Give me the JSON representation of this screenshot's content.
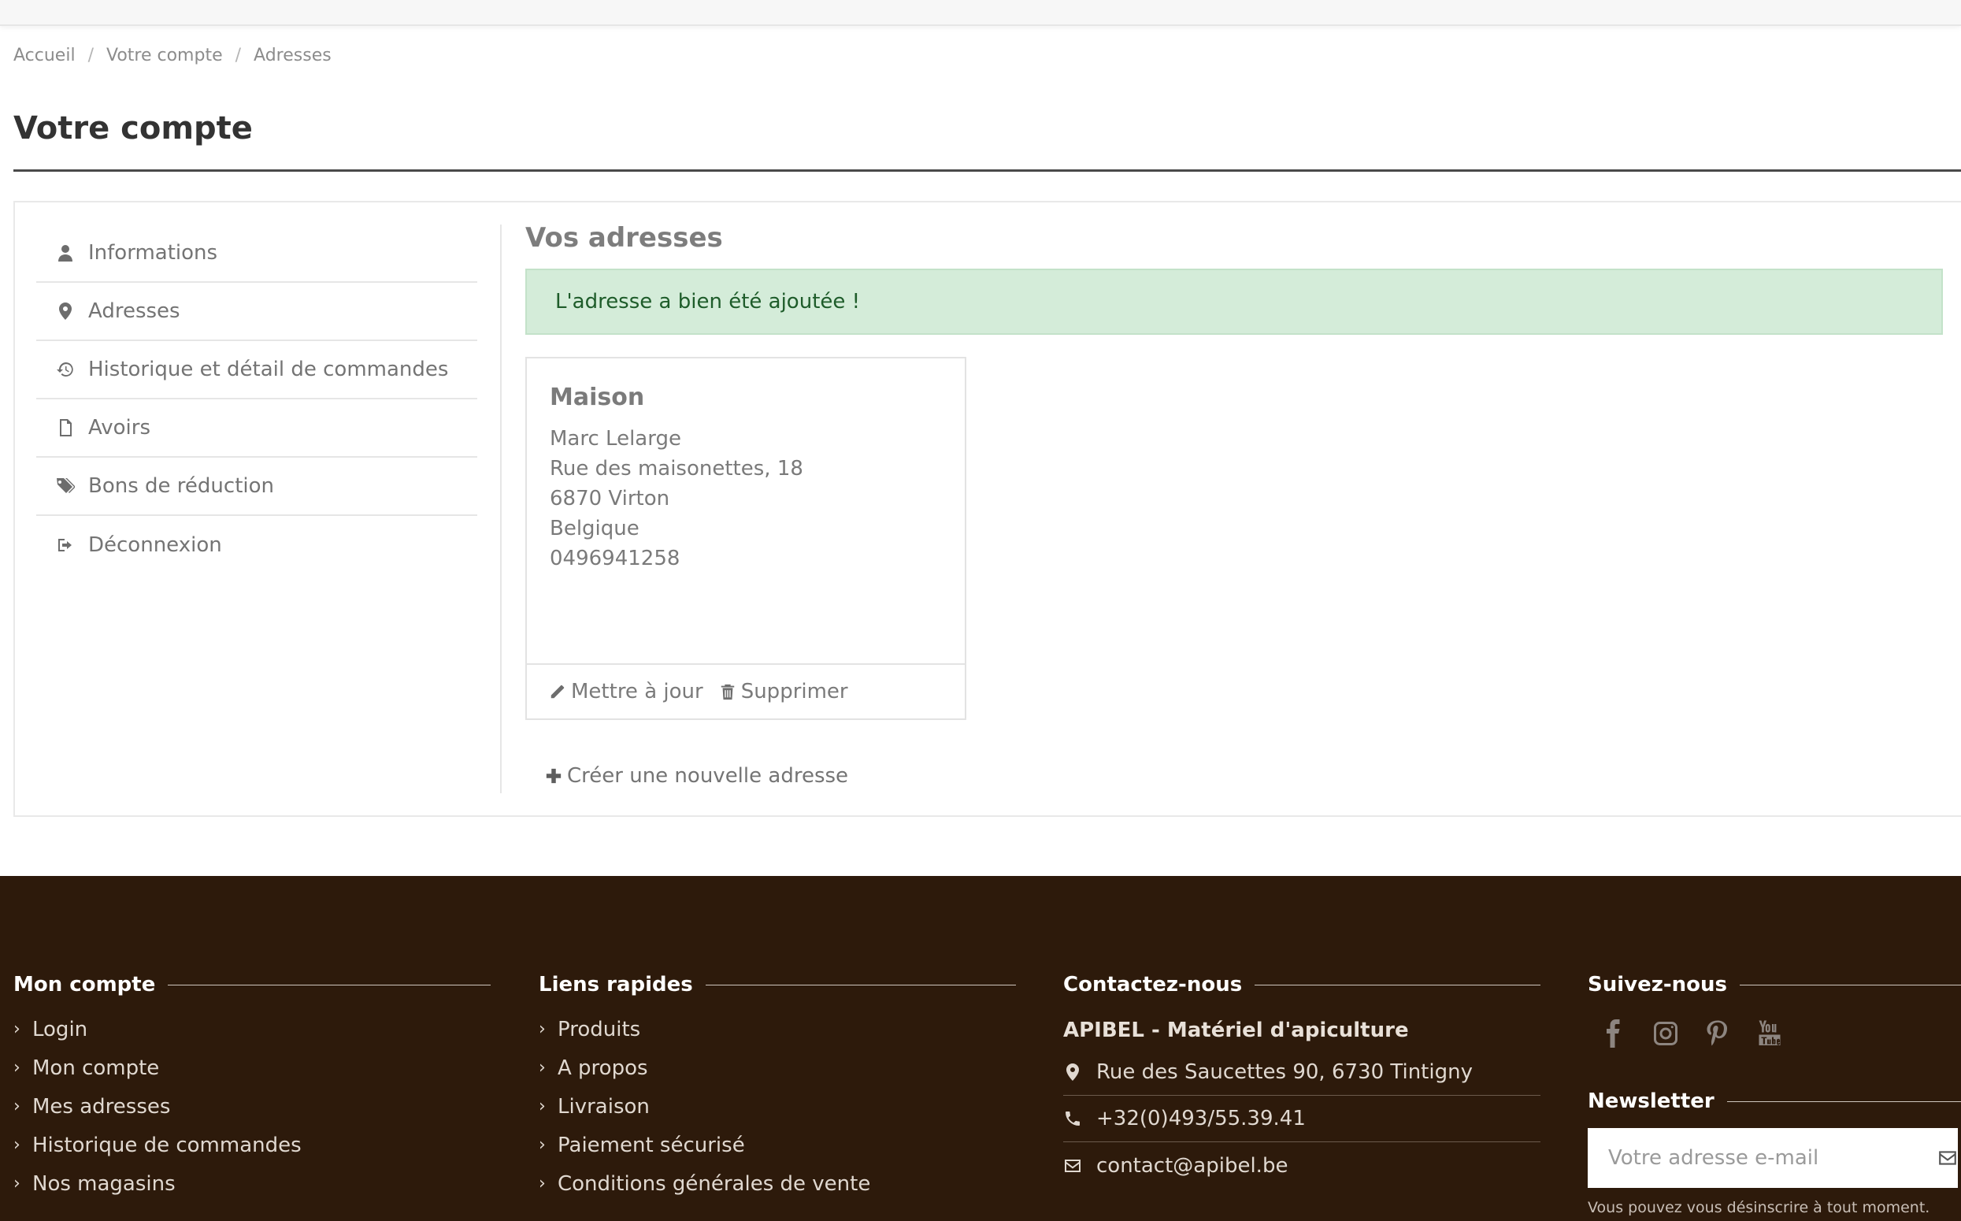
{
  "breadcrumb": [
    "Accueil",
    "Votre compte",
    "Adresses"
  ],
  "page_title": "Votre compte",
  "sidebar": {
    "items": [
      {
        "label": "Informations",
        "icon": "user-icon"
      },
      {
        "label": "Adresses",
        "icon": "map-marker-icon"
      },
      {
        "label": "Historique et détail de commandes",
        "icon": "history-icon"
      },
      {
        "label": "Avoirs",
        "icon": "file-icon"
      },
      {
        "label": "Bons de réduction",
        "icon": "tags-icon"
      },
      {
        "label": "Déconnexion",
        "icon": "sign-out-icon"
      }
    ]
  },
  "main": {
    "title": "Vos adresses",
    "alert": "L'adresse a bien été ajoutée !",
    "address": {
      "alias": "Maison",
      "lines": [
        "Marc Lelarge",
        "Rue des maisonettes, 18",
        "6870 Virton",
        "Belgique",
        "0496941258"
      ],
      "update_label": "Mettre à jour",
      "delete_label": "Supprimer"
    },
    "create_label": "Créer une nouvelle adresse"
  },
  "footer": {
    "account": {
      "title": "Mon compte",
      "links": [
        "Login",
        "Mon compte",
        "Mes adresses",
        "Historique de commandes",
        "Nos magasins"
      ]
    },
    "quick_links": {
      "title": "Liens rapides",
      "links": [
        "Produits",
        "A propos",
        "Livraison",
        "Paiement sécurisé",
        "Conditions générales de vente"
      ]
    },
    "contact": {
      "title": "Contactez-nous",
      "company": "APIBEL - Matériel d'apiculture",
      "address": "Rue des Saucettes 90, 6730 Tintigny",
      "phone": "+32(0)493/55.39.41",
      "email": "contact@apibel.be"
    },
    "follow": {
      "title": "Suivez-nous",
      "networks": [
        "facebook-icon",
        "instagram-icon",
        "pinterest-icon",
        "youtube-icon"
      ]
    },
    "newsletter": {
      "title": "Newsletter",
      "placeholder": "Votre adresse e-mail",
      "note": "Vous pouvez vous désinscrire à tout moment."
    }
  },
  "colors": {
    "footer_bg": "#2d1a0b",
    "alert_bg": "#d4ecd9",
    "alert_text": "#1e5c2a"
  }
}
